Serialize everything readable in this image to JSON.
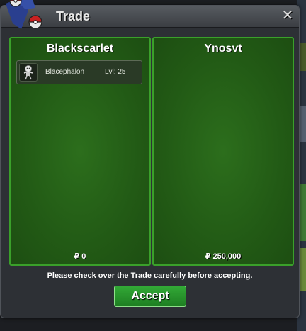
{
  "window": {
    "title": "Trade",
    "close_glyph": "✕"
  },
  "panels": [
    {
      "player": "Blackscarlet",
      "items": [
        {
          "name": "Blacephalon",
          "level": "Lvl: 25",
          "icon": "blacephalon-icon"
        }
      ],
      "money": "₽ 0"
    },
    {
      "player": "Ynosvt",
      "items": [],
      "money": "₽ 250,000"
    }
  ],
  "notice": "Please check over the Trade carefully before accepting.",
  "accept_label": "Accept",
  "colors": {
    "panel_green": "#225a15",
    "panel_border": "#3aa02a",
    "accept_green": "#2a9a2e"
  }
}
